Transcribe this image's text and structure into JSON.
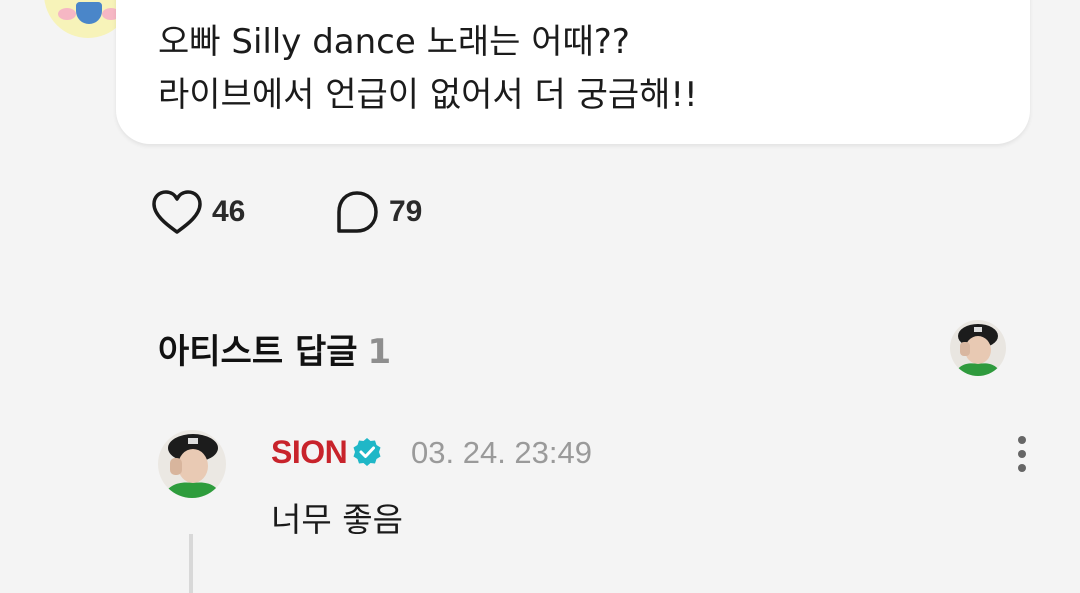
{
  "post": {
    "message_lines": [
      "오빠 Silly dance 노래는 어때??",
      "라이브에서 언급이 없어서 더 궁금해!!"
    ]
  },
  "actions": {
    "likes": "46",
    "comments": "79",
    "like_icon": "heart-outline-icon",
    "comment_icon": "speech-bubble-icon"
  },
  "artist_replies": {
    "title": "아티스트 답글",
    "count": "1"
  },
  "reply": {
    "author": "SION",
    "time": "03. 24. 23:49",
    "text": "너무 좋음",
    "verified_icon": "verified-badge-icon"
  },
  "colors": {
    "author_red": "#c8232b",
    "verified_teal": "#1fb7c7",
    "muted_gray": "#9a9a9a",
    "bubble_white": "#ffffff",
    "background": "#f4f4f4"
  }
}
